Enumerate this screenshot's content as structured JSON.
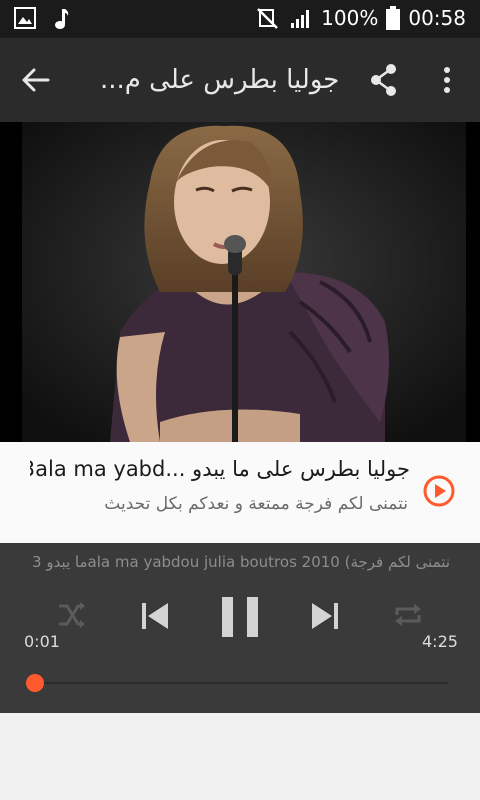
{
  "status_bar": {
    "battery_percent": "100%",
    "time": "00:58",
    "left_icons": [
      "image-icon",
      "music-note-icon"
    ],
    "right_icons": [
      "vibrate-mute-icon",
      "signal-icon",
      "battery-icon"
    ]
  },
  "toolbar": {
    "title": "جوليا بطرس على م...",
    "icons": [
      "back-arrow-icon",
      "share-icon",
      "more-vert-icon"
    ]
  },
  "track": {
    "title": "جوليا بطرس على ما يبدو ...3ala ma yabd",
    "subtitle": "نتمنى لكم فرجة ممتعة و نعدكم بكل تحديث",
    "accent_color": "#ff5a2e"
  },
  "player": {
    "ticker": "ما يبدو 3ala ma yabdou julia boutros 2010 (نتمنى لكم فرجة",
    "elapsed": "0:01",
    "total": "4:25",
    "progress_fraction": 0.004,
    "state": "playing",
    "controls": [
      "shuffle-icon",
      "skip-previous-icon",
      "pause-icon",
      "skip-next-icon",
      "repeat-icon"
    ]
  }
}
